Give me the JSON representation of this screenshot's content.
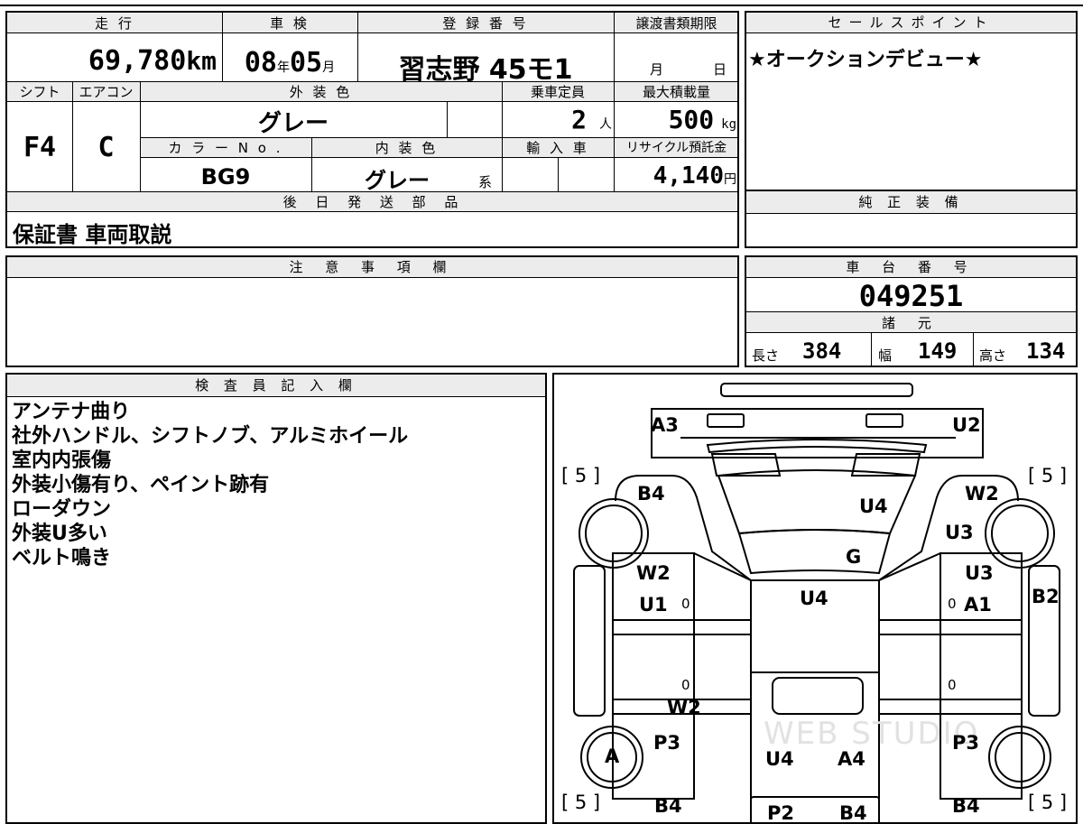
{
  "top_table": {
    "mileage_label": "走 行",
    "mileage_value": "69,780",
    "mileage_unit": "km",
    "inspection_label": "車 検",
    "inspection_year": "08",
    "inspection_year_unit": "年",
    "inspection_month": "05",
    "inspection_month_unit": "月",
    "registration_label": "登 録 番 号",
    "registration_value": "習志野 45モ1",
    "transfer_label": "譲渡書類期限",
    "transfer_month_unit": "月",
    "transfer_day_unit": "日",
    "shift_label": "シフト",
    "shift_value": "F4",
    "ac_label": "エアコン",
    "ac_value": "C",
    "exterior_color_label": "外 装 色",
    "exterior_color_value": "グレー",
    "capacity_label": "乗車定員",
    "capacity_value": "2",
    "capacity_unit": "人",
    "max_load_label": "最大積載量",
    "max_load_value": "500",
    "max_load_unit": "kg",
    "color_no_label": "カ ラ ー N o .",
    "color_no_value": "BG9",
    "interior_color_label": "内 装 色",
    "interior_color_value": "グレー",
    "interior_color_suffix": "系",
    "import_label": "輸 入 車",
    "recycle_label": "リサイクル預託金",
    "recycle_value": "4,140",
    "recycle_unit": "円",
    "later_parts_label": "後 日 発 送 部 品",
    "later_parts_value": "保証書 車両取説"
  },
  "sales_point": {
    "label": "セールスポイント",
    "text": "★オークションデビュー★"
  },
  "genuine_equipment": {
    "label": "純 正 装 備"
  },
  "notes": {
    "label": "注 意 事 項 欄"
  },
  "chassis": {
    "label": "車 台 番 号",
    "value": "049251"
  },
  "specs": {
    "label": "諸 元",
    "length_label": "長さ",
    "length_value": "384",
    "width_label": "幅",
    "width_value": "149",
    "height_label": "高さ",
    "height_value": "134"
  },
  "inspector": {
    "label": "検 査 員 記 入 欄",
    "lines": [
      "アンテナ曲り",
      "社外ハンドル、シフトノブ、アルミホイール",
      "室内内張傷",
      "外装小傷有り、ペイント跡有",
      "ローダウン",
      "外装U多い",
      "ベルト鳴き"
    ]
  },
  "diagram": {
    "watermark": "WEB STUDIO",
    "marks": {
      "a3": "A3",
      "u2": "U2",
      "b4_left": "B4",
      "w2_right_top": "W2",
      "u4_roof": "U4",
      "u3_right_upper": "U3",
      "g_glass": "G",
      "w2_left": "W2",
      "u1_left": "U1",
      "u4_hood": "U4",
      "u3_right": "U3",
      "a1_right": "A1",
      "b2_right": "B2",
      "w2_bottom": "W2",
      "a_wheel": "A",
      "p3_left": "P3",
      "p3_right": "P3",
      "u4_bottom": "U4",
      "a4_bottom": "A4",
      "b4_bottom_left": "B4",
      "b4_bottom_right": "B4",
      "p2_bottom": "P2",
      "b4_bottom_mid": "B4",
      "five_tl": "[ 5 ]",
      "five_tr": "[ 5 ]",
      "five_bl": "[ 5 ]",
      "five_br": "[ 5 ]",
      "zero": "0"
    }
  }
}
